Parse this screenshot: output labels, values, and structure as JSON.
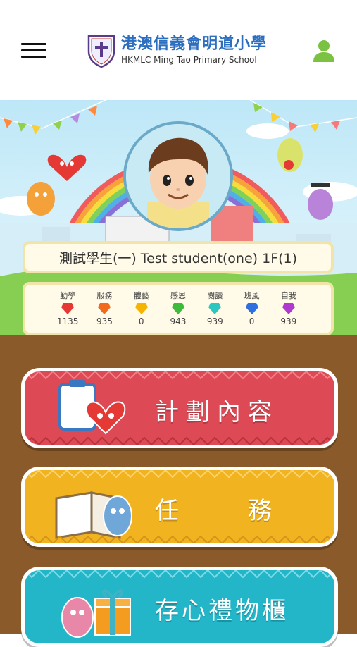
{
  "header": {
    "school_name_zh": "港澳信義會明道小學",
    "school_name_en": "HKMLC Ming Tao Primary School"
  },
  "student": {
    "name": "測試學生(一) Test student(one) 1F(1)"
  },
  "scores": [
    {
      "label": "勤學",
      "value": "1135",
      "color": "#e53935"
    },
    {
      "label": "服務",
      "value": "935",
      "color": "#f26a1b"
    },
    {
      "label": "體藝",
      "value": "0",
      "color": "#f4b400"
    },
    {
      "label": "感恩",
      "value": "943",
      "color": "#3dbb3d"
    },
    {
      "label": "閱讀",
      "value": "939",
      "color": "#2ec7c0"
    },
    {
      "label": "班風",
      "value": "0",
      "color": "#2f6fe0"
    },
    {
      "label": "自我",
      "value": "939",
      "color": "#b03ad0"
    }
  ],
  "buttons": {
    "plan": "計劃內容",
    "task": "任　　務",
    "gift": "存心禮物櫃"
  },
  "colors": {
    "plan": "#dd4a55",
    "task": "#f2b321",
    "gift": "#23b6c8",
    "user_icon": "#7bc142",
    "school_blue": "#2c6fc0"
  }
}
